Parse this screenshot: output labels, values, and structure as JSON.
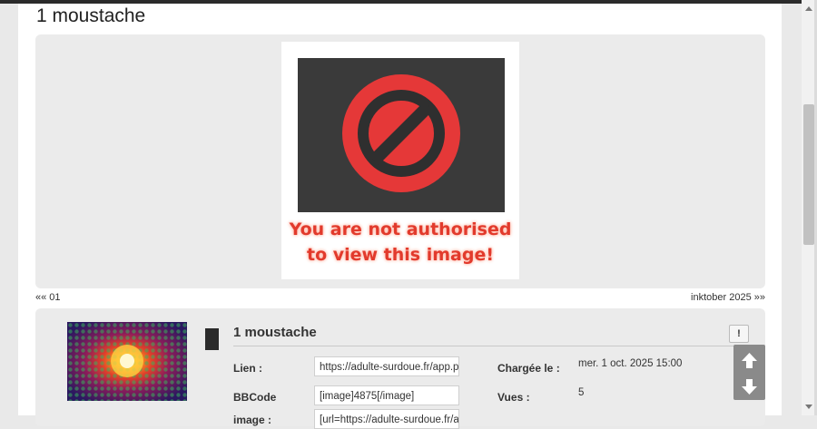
{
  "title": "1 moustache",
  "image": {
    "message_line1": "You are not authorised",
    "message_line2": "to view this image!"
  },
  "pager": {
    "prev": "«« 01",
    "next": "inktober 2025 »»"
  },
  "details": {
    "title": "1 moustache",
    "report_label": "!",
    "lien_label": "Lien :",
    "lien_value": "https://adulte-surdoue.fr/app.ph",
    "bbcode_label": "BBCode",
    "bbcode_value": "[image]4875[/image]",
    "image_label": "image :",
    "image_value": "[url=https://adulte-surdoue.fr/ar",
    "uploaded_label": "Chargée le :",
    "uploaded_value": "mer. 1 oct. 2025 15:00",
    "views_label": "Vues :",
    "views_value": "5"
  },
  "colors": {
    "accent_red": "#e23a2c",
    "dark": "#3a3a3a"
  },
  "icons": [
    "forbidden-icon",
    "arrow-up-icon",
    "arrow-down-icon",
    "exclamation-icon"
  ]
}
